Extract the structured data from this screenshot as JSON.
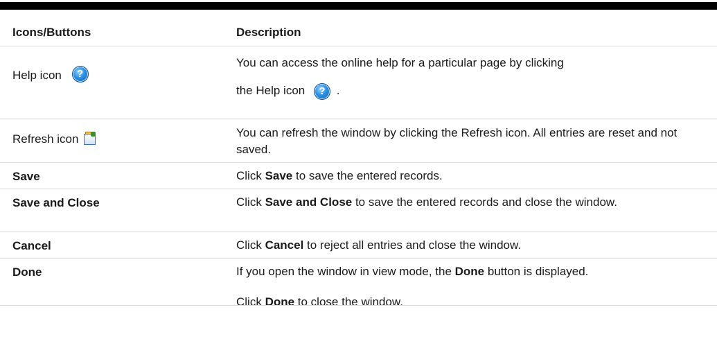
{
  "table": {
    "header": {
      "col1": "Icons/Buttons",
      "col2": "Description"
    },
    "rows": [
      {
        "name": "Help icon",
        "desc_a": "You can access the online help for a particular page by clicking",
        "desc_b": "the Help icon",
        "desc_c": "."
      },
      {
        "name": "Refresh icon",
        "desc": "You can refresh the window by clicking the Refresh icon. All entries are reset and not saved."
      },
      {
        "name": "Save",
        "desc_pre": "Click ",
        "desc_bold": "Save",
        "desc_post": " to save the entered records."
      },
      {
        "name": "Save and Close",
        "desc_pre": "Click ",
        "desc_bold": "Save and Close",
        "desc_post": " to save the entered records and close the window."
      },
      {
        "name": "Cancel",
        "desc_pre": "Click ",
        "desc_bold": "Cancel",
        "desc_post": " to reject all entries and close the window."
      },
      {
        "name": "Done",
        "desc1_pre": "If you open the window in view mode, the ",
        "desc1_bold": "Done",
        "desc1_post": " button is displayed.",
        "desc2_pre": "Click ",
        "desc2_bold": "Done",
        "desc2_post": " to close the window."
      }
    ]
  },
  "icons": {
    "help": "help-icon",
    "refresh": "refresh-icon",
    "help_glyph": "?"
  },
  "colors": {
    "rule": "#000000",
    "divider": "#d9d9d9",
    "help_blue": "#2a8fe0"
  }
}
